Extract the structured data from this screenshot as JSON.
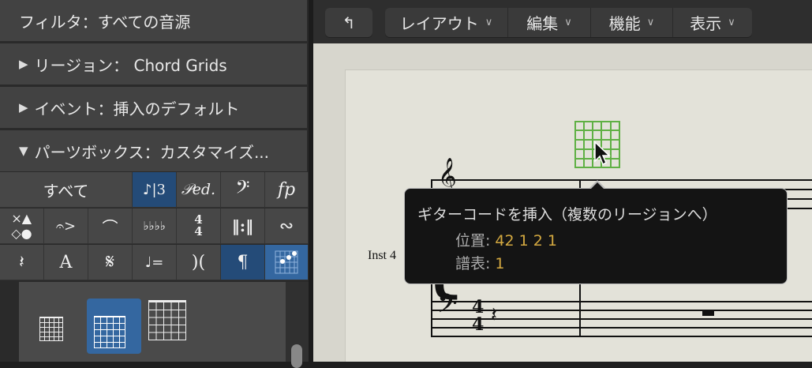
{
  "sidebar": {
    "filter": "フィルタ：すべての音源",
    "region": "リージョン： Chord Grids",
    "event": "イベント：挿入のデフォルト",
    "partsbox": "パーツボックス：カスタマイズ...",
    "all_label": "すべて",
    "symbols": {
      "pedal": "𝒫ed.",
      "fp": "fp",
      "time": "4\n4",
      "paragraph": "¶",
      "text": "A",
      "segno": "𝄋",
      "tempo": "♩=",
      "flats": "♭♭♭♭",
      "bass_clef": "𝄢",
      "rest": "𝄽"
    }
  },
  "toolbar": {
    "back": "↰",
    "menus": [
      "レイアウト",
      "編集",
      "機能",
      "表示"
    ]
  },
  "score": {
    "instrument": "Inst 4"
  },
  "tooltip": {
    "title": "ギターコードを挿入（複数のリージョンへ）",
    "position_label": "位置:",
    "position_value": "42 1 2 1",
    "staff_label": "譜表:",
    "staff_value": "1"
  },
  "colors": {
    "selected": "#244b78",
    "accent": "#3467a0",
    "tooltip_value": "#d4a940",
    "chord_grid": "#5fb044"
  }
}
